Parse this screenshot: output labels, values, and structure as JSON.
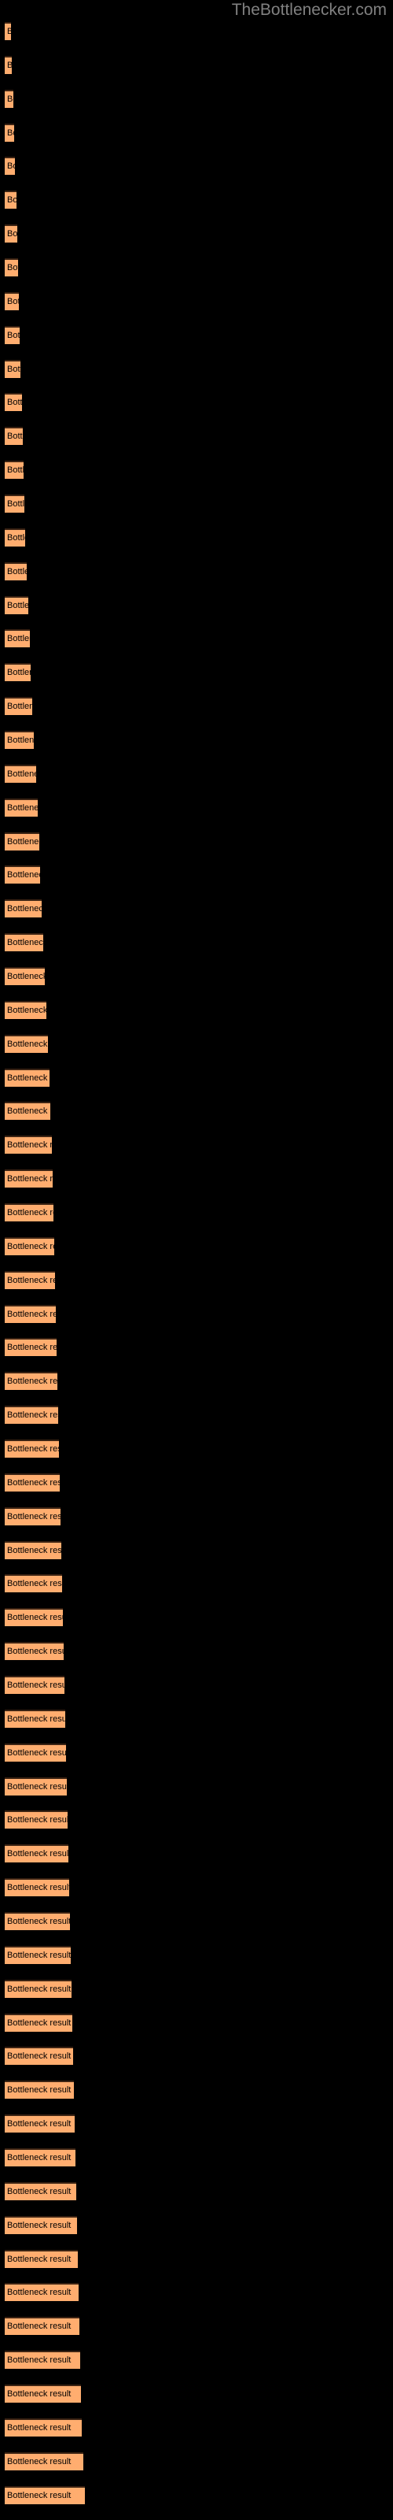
{
  "watermark": {
    "text": "TheBottlenecker.com",
    "color": "#808080"
  },
  "colors": {
    "background": "#000000",
    "bar_fill": "#ffad6f",
    "bar_border_top": "#3b2313",
    "label_text": "#000000",
    "watermark_text": "#808080"
  },
  "bar_label_text": "Bottleneck result",
  "chart_data": {
    "type": "bar",
    "orientation": "horizontal",
    "title": "",
    "subtitle": "",
    "xlabel": "",
    "ylabel": "",
    "grid": false,
    "legend": null,
    "axis_labels_visible": false,
    "tick_labels_visible": false,
    "bar_label": "Bottleneck result",
    "xlim": [
      0,
      102
    ],
    "categories": [
      "Bottleneck result",
      "Bottleneck result",
      "Bottleneck result",
      "Bottleneck result",
      "Bottleneck result",
      "Bottleneck result",
      "Bottleneck result",
      "Bottleneck result",
      "Bottleneck result",
      "Bottleneck result",
      "Bottleneck result",
      "Bottleneck result",
      "Bottleneck result",
      "Bottleneck result",
      "Bottleneck result",
      "Bottleneck result",
      "Bottleneck result",
      "Bottleneck result",
      "Bottleneck result",
      "Bottleneck result",
      "Bottleneck result",
      "Bottleneck result",
      "Bottleneck result",
      "Bottleneck result",
      "Bottleneck result",
      "Bottleneck result",
      "Bottleneck result",
      "Bottleneck result",
      "Bottleneck result",
      "Bottleneck result",
      "Bottleneck result",
      "Bottleneck result",
      "Bottleneck result",
      "Bottleneck result",
      "Bottleneck result",
      "Bottleneck result",
      "Bottleneck result",
      "Bottleneck result",
      "Bottleneck result",
      "Bottleneck result",
      "Bottleneck result",
      "Bottleneck result",
      "Bottleneck result",
      "Bottleneck result",
      "Bottleneck result",
      "Bottleneck result",
      "Bottleneck result",
      "Bottleneck result",
      "Bottleneck result",
      "Bottleneck result",
      "Bottleneck result",
      "Bottleneck result",
      "Bottleneck result",
      "Bottleneck result",
      "Bottleneck result",
      "Bottleneck result",
      "Bottleneck result",
      "Bottleneck result",
      "Bottleneck result",
      "Bottleneck result",
      "Bottleneck result",
      "Bottleneck result",
      "Bottleneck result",
      "Bottleneck result",
      "Bottleneck result",
      "Bottleneck result",
      "Bottleneck result",
      "Bottleneck result",
      "Bottleneck result",
      "Bottleneck result",
      "Bottleneck result",
      "Bottleneck result",
      "Bottleneck result",
      "Bottleneck result"
    ],
    "values": [
      8,
      9,
      11,
      12,
      13,
      15,
      16,
      17,
      18,
      19,
      20,
      22,
      23,
      24,
      25,
      26,
      28,
      30,
      32,
      33,
      35,
      37,
      40,
      42,
      44,
      45,
      47,
      49,
      51,
      53,
      55,
      57,
      58,
      60,
      61,
      62,
      63,
      64,
      65,
      66,
      67,
      68,
      69,
      70,
      71,
      72,
      73,
      74,
      75,
      76,
      77,
      78,
      79,
      80,
      81,
      82,
      83,
      84,
      85,
      86,
      87,
      88,
      89,
      90,
      91,
      92,
      93,
      94,
      95,
      96,
      97,
      98,
      100,
      102
    ],
    "bar_tops": [
      28,
      71,
      114,
      157,
      199,
      242,
      285,
      328,
      371,
      414,
      457,
      499,
      542,
      585,
      628,
      671,
      714,
      757,
      799,
      842,
      885,
      928,
      971,
      1014,
      1057,
      1099,
      1142,
      1185,
      1228,
      1271,
      1314,
      1357,
      1399,
      1442,
      1485,
      1528,
      1571,
      1614,
      1657,
      1699,
      1742,
      1785,
      1828,
      1871,
      1914,
      1957,
      1999,
      2042,
      2085,
      2128,
      2171,
      2214,
      2257,
      2299,
      2342,
      2385,
      2428,
      2471,
      2514,
      2557,
      2599,
      2642,
      2685,
      2728,
      2771,
      2814,
      2857,
      2899,
      2942,
      2985,
      3028,
      3071,
      3114,
      3157
    ]
  }
}
